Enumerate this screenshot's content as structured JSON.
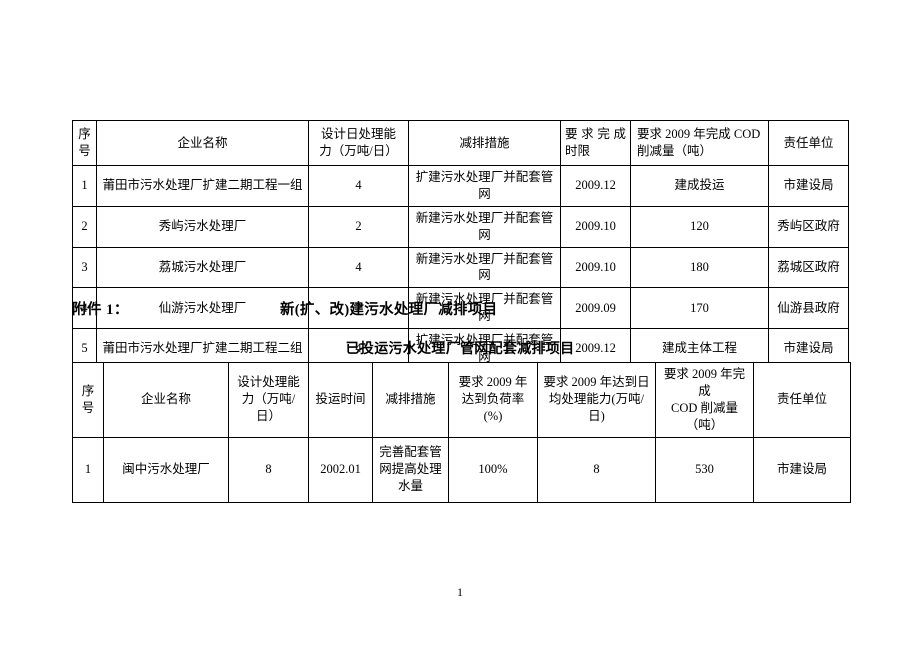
{
  "document": {
    "page_number": "1",
    "attachment_label": "附件 1：",
    "title_one": "新(扩、改)建污水处理厂减排项目",
    "title_two": "已投运污水处理厂管网配套减排项目"
  },
  "table_one": {
    "headers": {
      "index_1": "序",
      "index_2": "号",
      "enterprise_name": "企业名称",
      "capacity_1": "设计日处理能",
      "capacity_2": "力（万吨/日）",
      "measure": "减排措施",
      "deadline_1": "要求完成",
      "deadline_2": "时限",
      "cod_1": "要求 2009 年完成 COD",
      "cod_2": "削减量（吨）",
      "unit": "责任单位"
    },
    "rows": [
      {
        "index": "1",
        "enterprise_name": "莆田市污水处理厂扩建二期工程一组",
        "capacity": "4",
        "measure": "扩建污水处理厂并配套管网",
        "deadline": "2009.12",
        "cod": "建成投运",
        "unit": "市建设局"
      },
      {
        "index": "2",
        "enterprise_name": "秀屿污水处理厂",
        "capacity": "2",
        "measure": "新建污水处理厂并配套管网",
        "deadline": "2009.10",
        "cod": "120",
        "unit": "秀屿区政府"
      },
      {
        "index": "3",
        "enterprise_name": "荔城污水处理厂",
        "capacity": "4",
        "measure": "新建污水处理厂并配套管网",
        "deadline": "2009.10",
        "cod": "180",
        "unit": "荔城区政府"
      },
      {
        "index": "4",
        "enterprise_name": "仙游污水处理厂",
        "capacity": "2",
        "measure": "新建污水处理厂并配套管网",
        "deadline": "2009.09",
        "cod": "170",
        "unit": "仙游县政府"
      },
      {
        "index": "5",
        "enterprise_name": "莆田市污水处理厂扩建二期工程二组",
        "capacity": "4",
        "measure": "扩建污水处理厂并配套管网",
        "deadline": "2009.12",
        "cod": "建成主体工程",
        "unit": "市建设局"
      }
    ]
  },
  "table_two": {
    "headers": {
      "index_1": "序",
      "index_2": "号",
      "enterprise_name": "企业名称",
      "capacity_1": "设计处理能",
      "capacity_2": "力（万吨/日）",
      "operation_date": "投运时间",
      "measure": "减排措施",
      "load_rate_1": "要求 2009 年",
      "load_rate_2": "达到负荷率(%)",
      "daily_capacity_1": "要求 2009 年达到日",
      "daily_capacity_2": "均处理能力(万吨/日)",
      "cod_1": "要求 2009 年完成",
      "cod_2": "COD 削减量（吨）",
      "unit": "责任单位"
    },
    "rows": [
      {
        "index": "1",
        "enterprise_name": "闽中污水处理厂",
        "capacity": "8",
        "operation_date": "2002.01",
        "measure_line1": "完善配套管",
        "measure_line2": "网提高处理",
        "measure_line3": "水量",
        "load_rate": "100%",
        "daily_capacity": "8",
        "cod": "530",
        "unit": "市建设局"
      }
    ]
  }
}
